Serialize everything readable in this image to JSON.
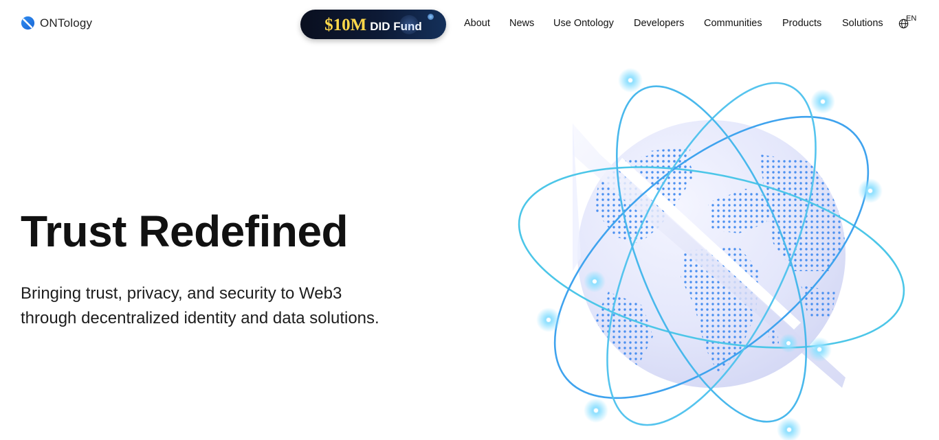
{
  "header": {
    "logo": {
      "name": "ONTology",
      "name_strong": "ONT",
      "name_rest": "ology"
    },
    "promo": {
      "amount": "$10M",
      "label": "DID Fund"
    },
    "nav": [
      {
        "label": "About"
      },
      {
        "label": "News"
      },
      {
        "label": "Use Ontology"
      },
      {
        "label": "Developers"
      },
      {
        "label": "Communities"
      },
      {
        "label": "Products"
      },
      {
        "label": "Solutions"
      }
    ],
    "language": {
      "code": "EN",
      "icon": "globe-icon"
    }
  },
  "hero": {
    "title": "Trust Redefined",
    "subtitle_line1": "Bringing trust, privacy, and security to Web3",
    "subtitle_line2": "through decentralized identity and data solutions."
  },
  "colors": {
    "accent_blue": "#3b8fe6",
    "orbit_cyan": "#4cc6e8",
    "globe_fill": "#e3e6fb",
    "text": "#111111"
  }
}
